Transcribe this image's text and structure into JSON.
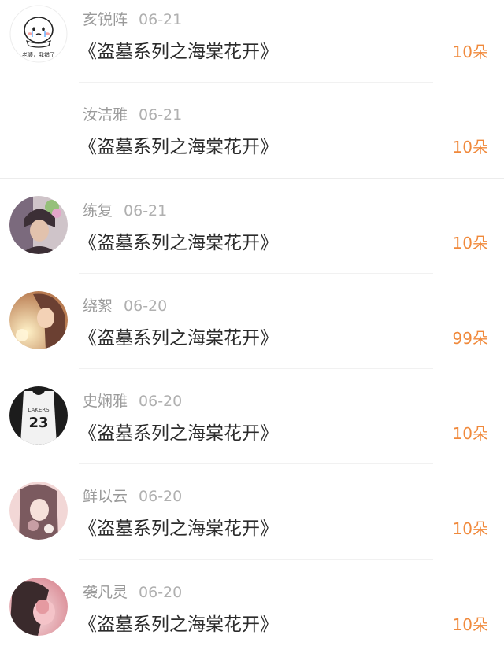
{
  "records": [
    {
      "name": "亥锐阵",
      "date": "06-21",
      "title": "《盗墓系列之海棠花开》",
      "count": "10朵",
      "avatar": {
        "type": "emoji",
        "caption": "老婆，我错了"
      }
    },
    {
      "name": "汝洁雅",
      "date": "06-21",
      "title": "《盗墓系列之海棠花开》",
      "count": "10朵",
      "avatar": {
        "type": "none"
      }
    },
    {
      "name": "练复",
      "date": "06-21",
      "title": "《盗墓系列之海棠花开》",
      "count": "10朵",
      "avatar": {
        "type": "photo",
        "colors": [
          "#3c2f36",
          "#7b6a7d",
          "#d9b9a4",
          "#95c07a"
        ]
      }
    },
    {
      "name": "绕絮",
      "date": "06-20",
      "title": "《盗墓系列之海棠花开》",
      "count": "99朵",
      "avatar": {
        "type": "photo",
        "colors": [
          "#f3c98a",
          "#c98b5a",
          "#6b4032",
          "#f7e3c0"
        ]
      }
    },
    {
      "name": "史娴雅",
      "date": "06-20",
      "title": "《盗墓系列之海棠花开》",
      "count": "10朵",
      "avatar": {
        "type": "jersey",
        "text": "23"
      }
    },
    {
      "name": "鲜以云",
      "date": "06-20",
      "title": "《盗墓系列之海棠花开》",
      "count": "10朵",
      "avatar": {
        "type": "photo",
        "colors": [
          "#f2d7d6",
          "#c79ea4",
          "#7b5a5f",
          "#f6ece8"
        ]
      }
    },
    {
      "name": "袭凡灵",
      "date": "06-20",
      "title": "《盗墓系列之海棠花开》",
      "count": "10朵",
      "avatar": {
        "type": "photo",
        "colors": [
          "#f4c3c8",
          "#e59aa1",
          "#b8626e",
          "#f9e4e6"
        ]
      }
    }
  ],
  "colors": {
    "name": "#9a9a9a",
    "title": "#2b2b2b",
    "count": "#f0893b",
    "divider": "#f1f1f1"
  }
}
